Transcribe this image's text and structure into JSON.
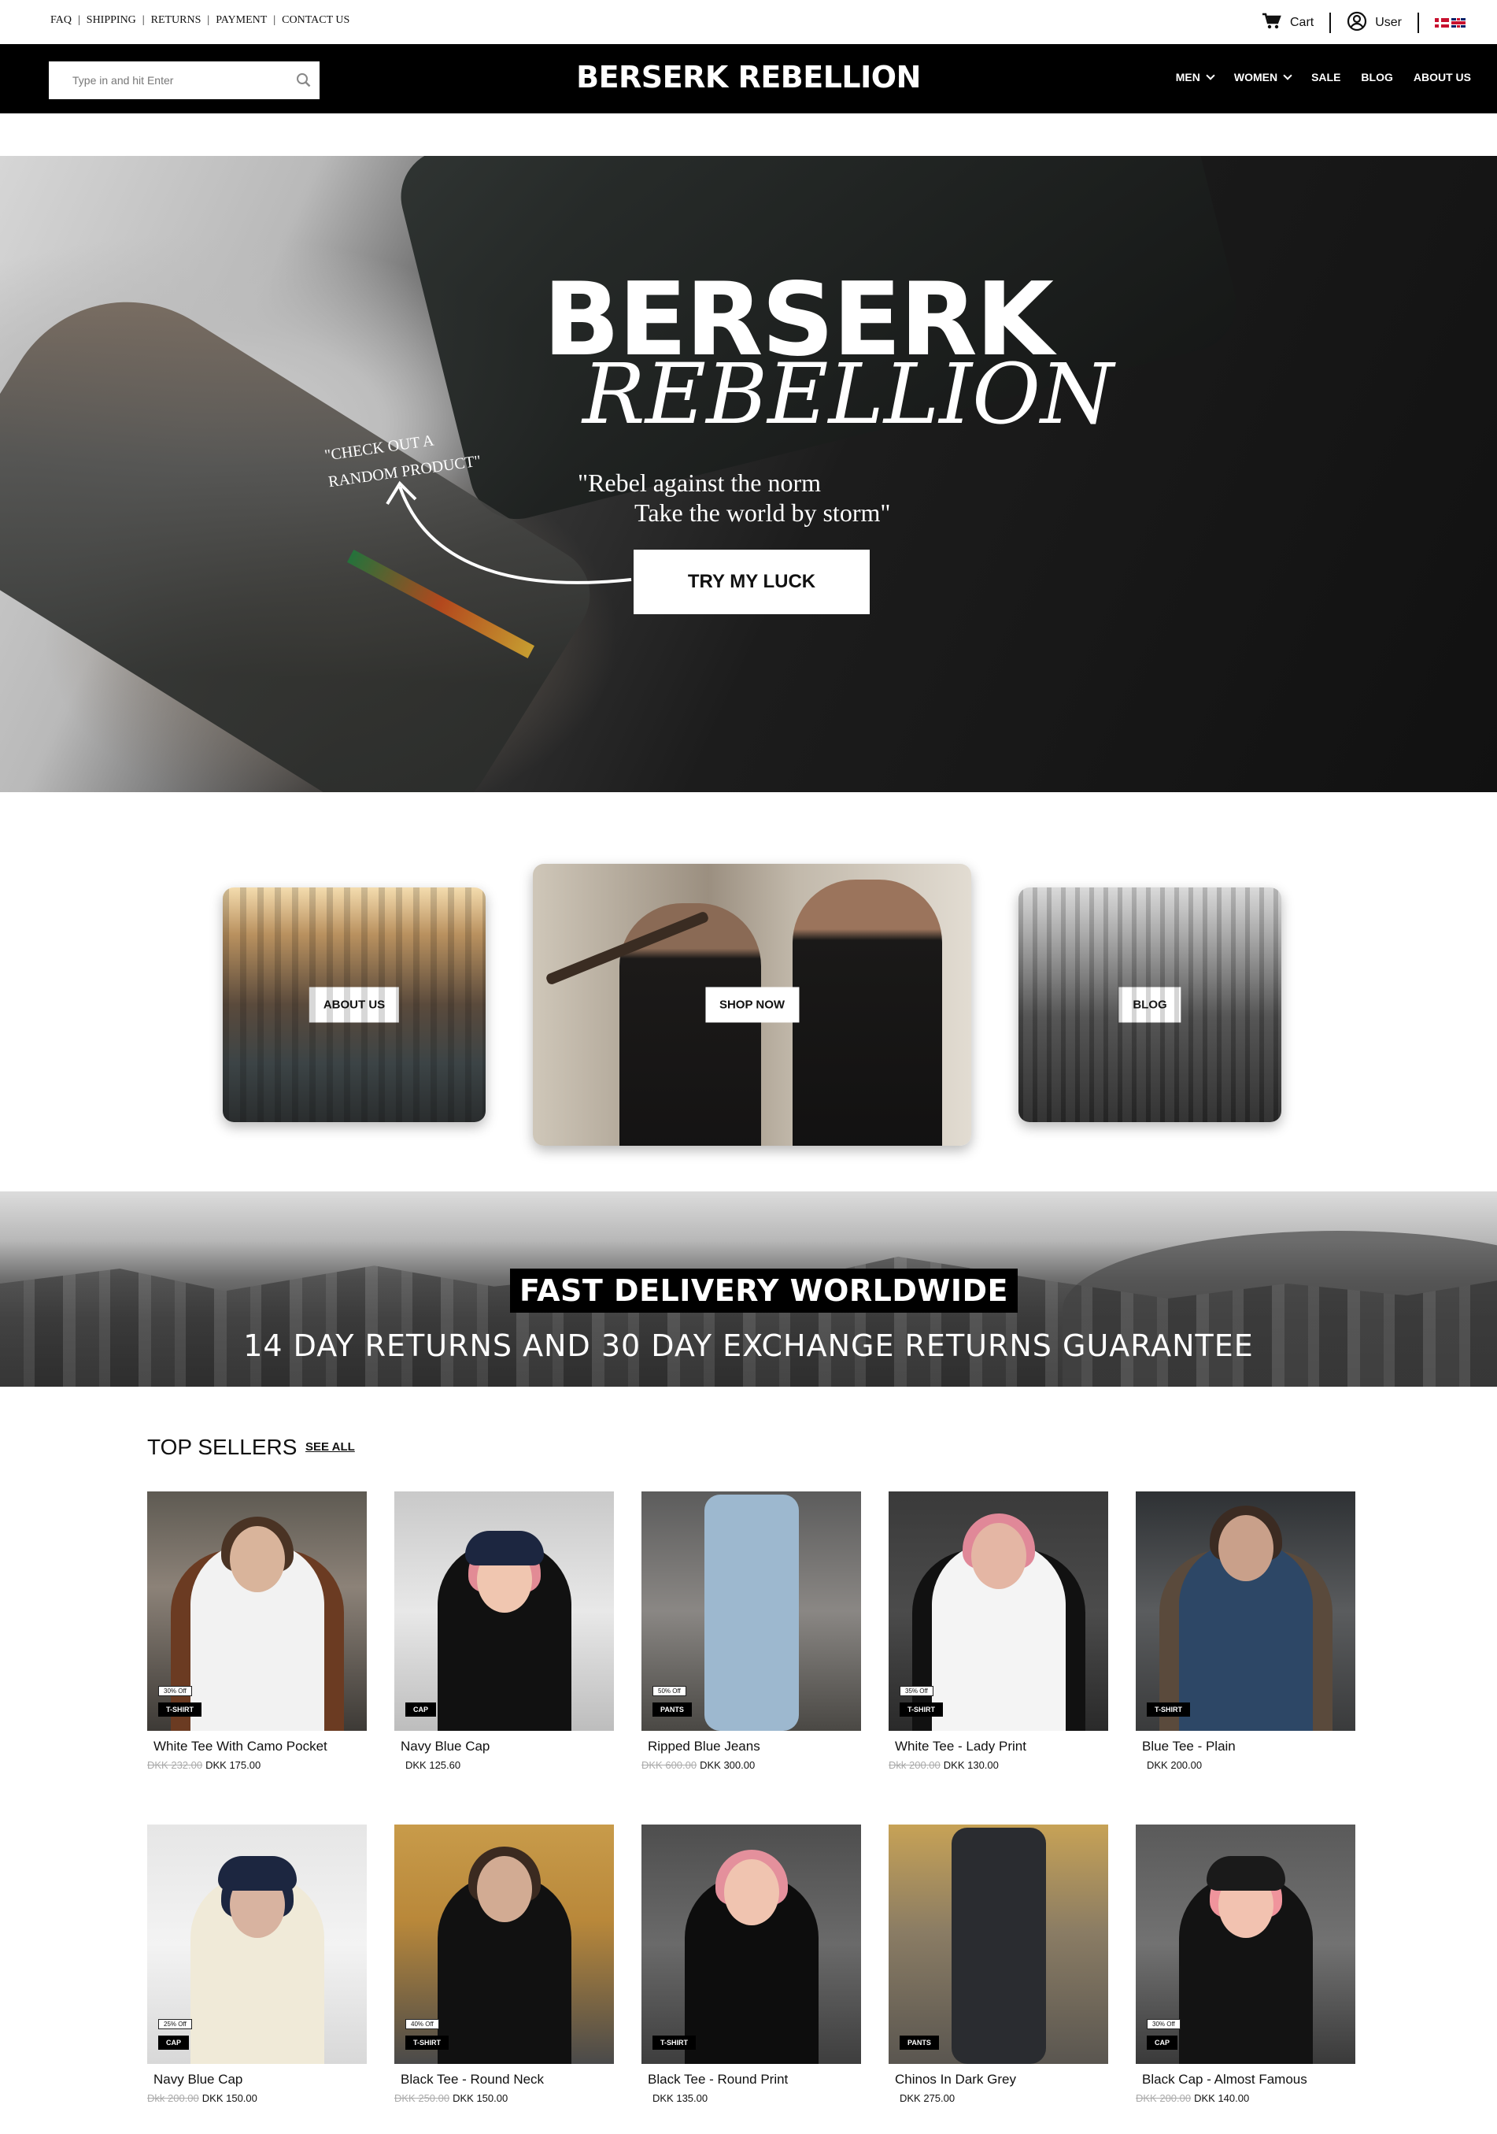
{
  "topbar": {
    "links": [
      "FAQ",
      "SHIPPING",
      "RETURNS",
      "PAYMENT",
      "CONTACT US"
    ],
    "cart_label": "Cart",
    "user_label": "User"
  },
  "nav": {
    "search_placeholder": "Type in and hit Enter",
    "brand": "BERSERK REBELLION",
    "menu": [
      "MEN",
      "WOMEN",
      "SALE",
      "BLOG",
      "ABOUT US"
    ]
  },
  "hero": {
    "title_line1": "BERSERK",
    "title_line2": "REBELLION",
    "quote_line1": "\"Rebel against the norm",
    "quote_line2": "Take the world by storm\"",
    "note_line1": "\"CHECK OUT A",
    "note_line2": "RANDOM PRODUCT\"",
    "button": "TRY MY LUCK"
  },
  "categories": {
    "about": "ABOUT US",
    "shop": "SHOP NOW",
    "blog": "BLOG"
  },
  "banner": {
    "headline": "FAST DELIVERY WORLDWIDE",
    "subline": "14 DAY RETURNS AND 30 DAY EXCHANGE RETURNS GUARANTEE"
  },
  "top_sellers": {
    "title": "TOP SELLERS",
    "see_all": "SEE ALL",
    "products": [
      {
        "name": "White Tee With Camo Pocket",
        "category": "T-SHIRT",
        "discount": "30% Off",
        "old_price": "DKK 232.00",
        "price": "DKK 175.00"
      },
      {
        "name": "Navy Blue Cap",
        "category": "CAP",
        "discount": "",
        "old_price": "",
        "price": "DKK 125.60"
      },
      {
        "name": "Ripped Blue Jeans",
        "category": "PANTS",
        "discount": "50% Off",
        "old_price": "DKK 600.00",
        "price": "DKK 300.00"
      },
      {
        "name": "White Tee - Lady Print",
        "category": "T-SHIRT",
        "discount": "35% Off",
        "old_price": "Dkk 200.00",
        "price": "DKK 130.00"
      },
      {
        "name": "Blue Tee - Plain",
        "category": "T-SHIRT",
        "discount": "",
        "old_price": "",
        "price": "DKK 200.00"
      },
      {
        "name": "Navy Blue Cap",
        "category": "CAP",
        "discount": "25% Off",
        "old_price": "Dkk 200.00",
        "price": "DKK 150.00"
      },
      {
        "name": "Black Tee - Round Neck",
        "category": "T-SHIRT",
        "discount": "40% Off",
        "old_price": "DKK 250.00",
        "price": "DKK 150.00"
      },
      {
        "name": "Black Tee - Round Print",
        "category": "T-SHIRT",
        "discount": "",
        "old_price": "",
        "price": "DKK 135.00"
      },
      {
        "name": "Chinos In Dark Grey",
        "category": "PANTS",
        "discount": "",
        "old_price": "",
        "price": "DKK 275.00"
      },
      {
        "name": "Black Cap - Almost Famous",
        "category": "CAP",
        "discount": "30% Off",
        "old_price": "DKK 200.00",
        "price": "DKK 140.00"
      }
    ]
  }
}
